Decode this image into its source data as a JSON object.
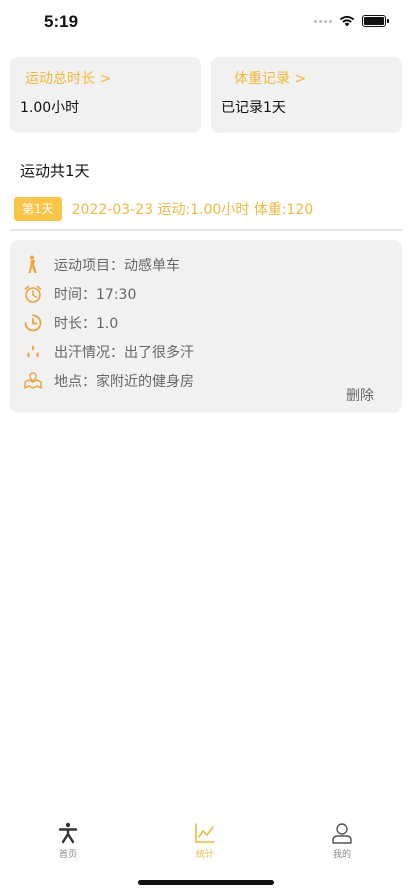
{
  "status_bar": {
    "time": "5:19"
  },
  "cards": {
    "exercise_total": {
      "title": "运动总时长 >",
      "value": "1.00小时"
    },
    "weight_record": {
      "title": "体重记录 >",
      "value": "已记录1天"
    }
  },
  "summary": "运动共1天",
  "day_entry": {
    "badge": "第1天",
    "info": "2022-03-23  运动:1.00小时 体重:120"
  },
  "record": {
    "items": [
      {
        "icon": "walking-person-icon",
        "text": "运动项目：动感单车"
      },
      {
        "icon": "alarm-clock-icon",
        "text": "时间：17:30"
      },
      {
        "icon": "clock-icon",
        "text": "时长：1.0"
      },
      {
        "icon": "sweat-drops-icon",
        "text": "出汗情况：出了很多汗"
      },
      {
        "icon": "map-pin-icon",
        "text": "地点：家附近的健身房"
      }
    ],
    "delete_label": "删除"
  },
  "tabs": [
    {
      "label": "首页",
      "icon": "exercise-person-icon",
      "active": false
    },
    {
      "label": "统计",
      "icon": "line-chart-icon",
      "active": true
    },
    {
      "label": "我的",
      "icon": "user-icon",
      "active": false
    }
  ],
  "colors": {
    "accent": "#f5b83a",
    "badge": "#f9c548",
    "card_bg": "#f1f1f1",
    "icon_orange": "#f0a23a"
  }
}
